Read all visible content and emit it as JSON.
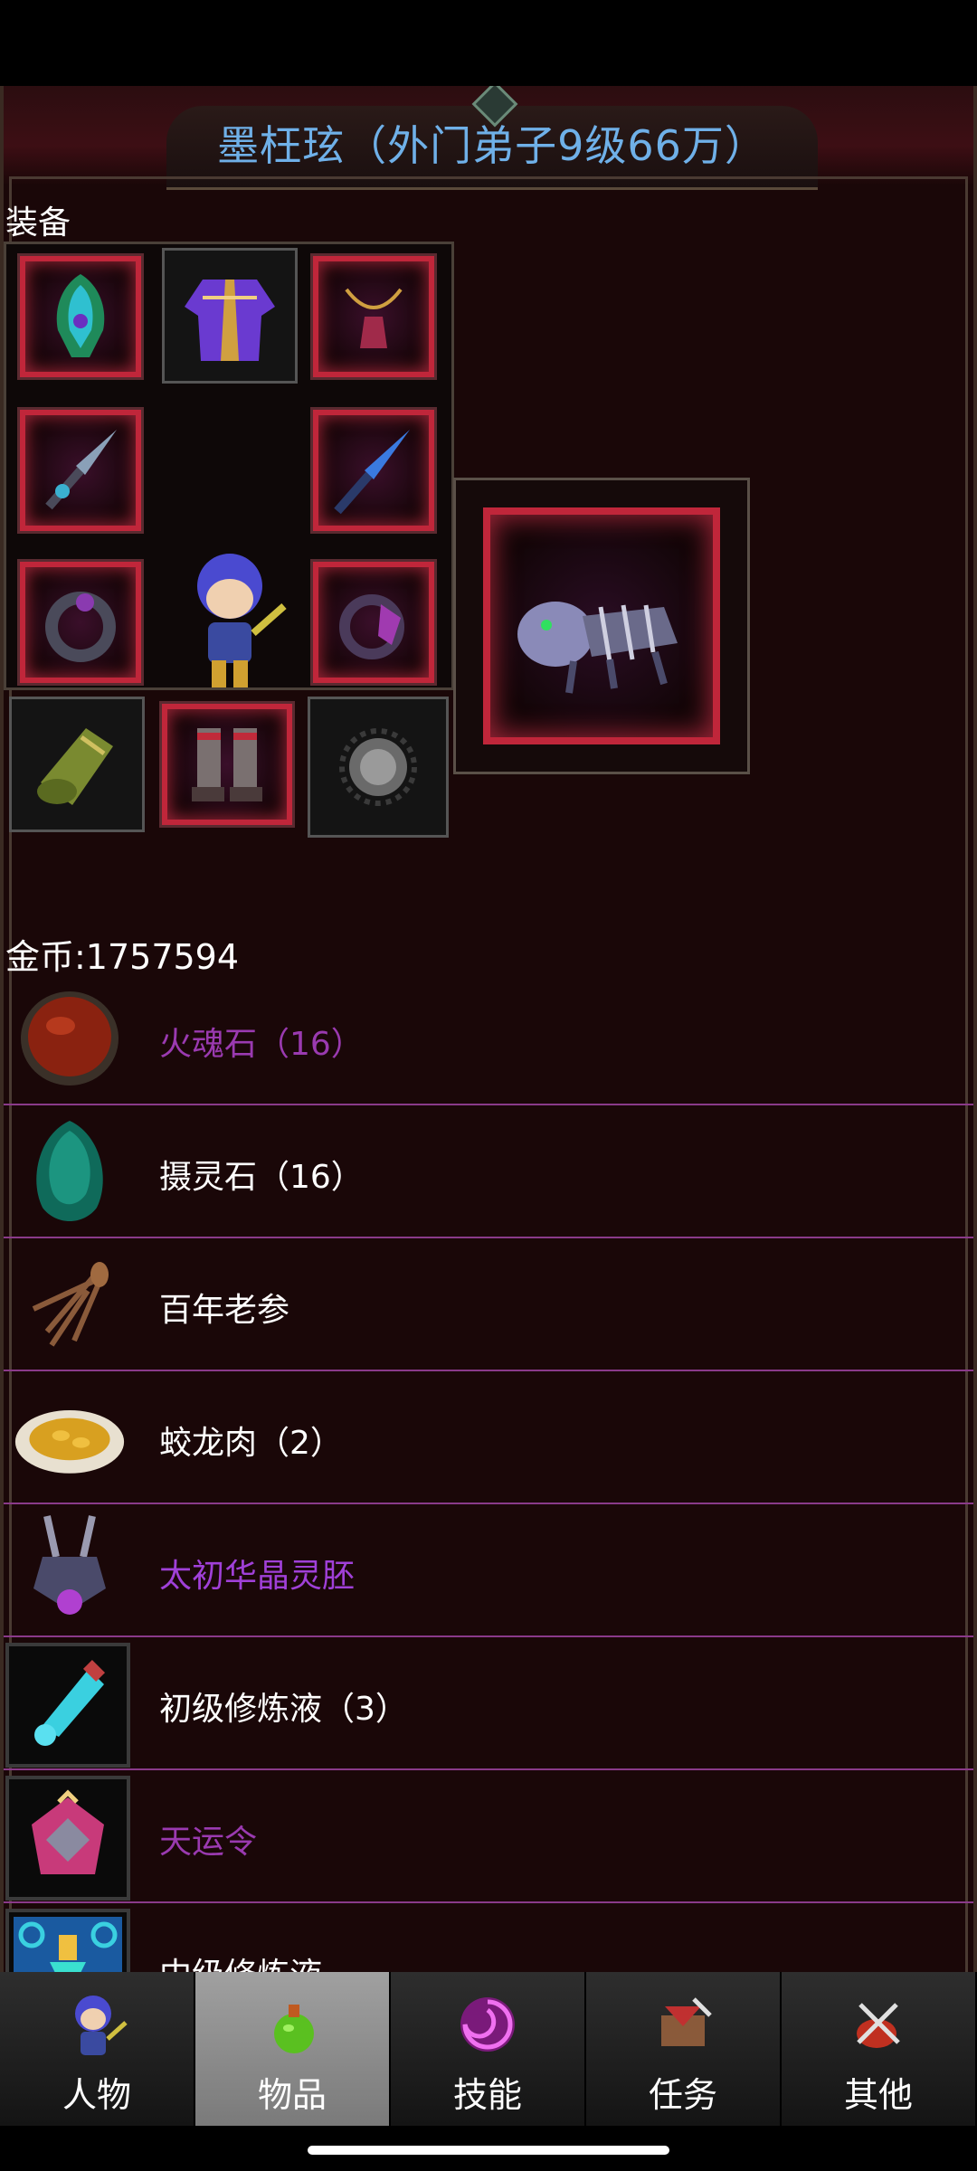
{
  "header": {
    "title": "墨枉玹（外门弟子9级66万）"
  },
  "equipment": {
    "label": "装备",
    "slots": [
      {
        "name": "helmet-icon",
        "glow": true
      },
      {
        "name": "robe-icon",
        "glow": false
      },
      {
        "name": "necklace-icon",
        "glow": true
      },
      {
        "name": "weapon-sword-icon",
        "glow": true
      },
      {
        "name": "blade-icon",
        "glow": true
      },
      {
        "name": "ring-left-icon",
        "glow": true
      },
      {
        "name": "ring-right-icon",
        "glow": true
      },
      {
        "name": "bracer-icon",
        "glow": false
      },
      {
        "name": "boots-icon",
        "glow": true
      },
      {
        "name": "orb-icon",
        "glow": false
      }
    ],
    "mount_icon": "mecha-beast-icon"
  },
  "gold": {
    "text": "金币:1757594"
  },
  "items": [
    {
      "name": "火魂石（16）",
      "color": "#9a3ab0",
      "icon": "fire-soul-stone-icon"
    },
    {
      "name": "摄灵石（16）",
      "color": "#ffffff",
      "icon": "spirit-stone-icon"
    },
    {
      "name": "百年老参",
      "color": "#ffffff",
      "icon": "ginseng-icon"
    },
    {
      "name": "蛟龙肉（2）",
      "color": "#ffffff",
      "icon": "dragon-meat-icon"
    },
    {
      "name": "太初华晶灵胚",
      "color": "#a040d8",
      "icon": "crystal-embryo-icon"
    },
    {
      "name": "初级修炼液（3）",
      "color": "#ffffff",
      "icon": "potion-vial-icon"
    },
    {
      "name": "天运令",
      "color": "#9a3ab0",
      "icon": "fortune-token-icon"
    },
    {
      "name": "中级修炼液",
      "color": "#ffffff",
      "icon": "elixir-flask-icon"
    }
  ],
  "tabs": [
    {
      "label": "人物",
      "icon": "character-icon",
      "active": false
    },
    {
      "label": "物品",
      "icon": "potion-bag-icon",
      "active": true
    },
    {
      "label": "技能",
      "icon": "skill-swirl-icon",
      "active": false
    },
    {
      "label": "任务",
      "icon": "quest-flag-icon",
      "active": false
    },
    {
      "label": "其他",
      "icon": "swords-icon",
      "active": false
    }
  ]
}
